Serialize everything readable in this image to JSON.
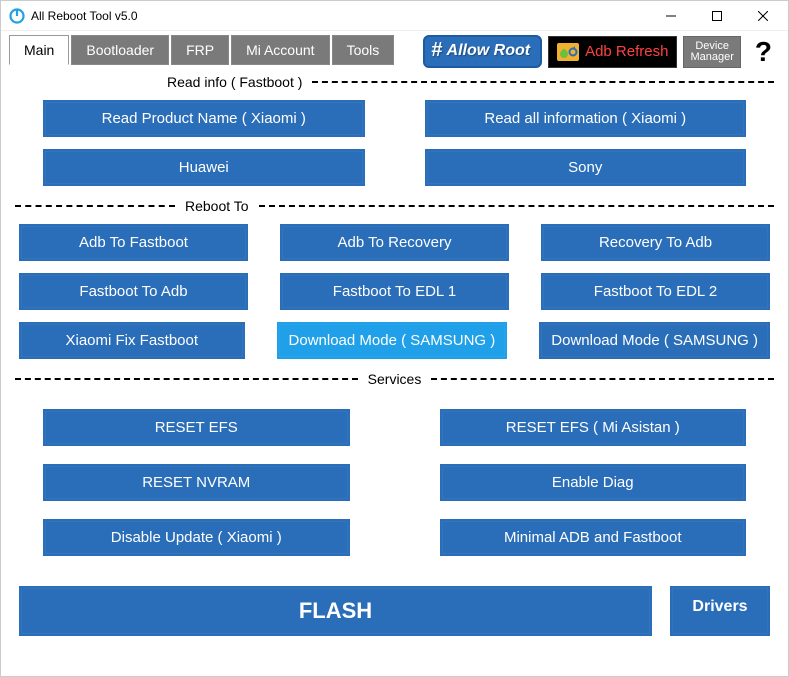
{
  "window": {
    "title": "All Reboot Tool v5.0"
  },
  "tabs": {
    "main": "Main",
    "bootloader": "Bootloader",
    "frp": "FRP",
    "mi_account": "Mi Account",
    "tools": "Tools"
  },
  "toolbar": {
    "allow_root": "Allow Root",
    "adb_refresh": "Adb Refresh",
    "device_manager": "Device\nManager",
    "help": "?"
  },
  "sections": {
    "read_info": "Read info ( Fastboot )",
    "reboot_to": "Reboot To",
    "services": "Services"
  },
  "read_info": {
    "read_product": "Read Product Name ( Xiaomi )",
    "read_all": "Read all information ( Xiaomi )",
    "huawei": "Huawei",
    "sony": "Sony"
  },
  "reboot": {
    "adb_to_fastboot": "Adb To Fastboot",
    "adb_to_recovery": "Adb To Recovery",
    "recovery_to_adb": "Recovery To Adb",
    "fastboot_to_adb": "Fastboot To Adb",
    "fastboot_to_edl1": "Fastboot To EDL 1",
    "fastboot_to_edl2": "Fastboot To EDL 2",
    "xiaomi_fix": "Xiaomi Fix Fastboot",
    "download_mode_a": "Download Mode ( SAMSUNG )",
    "download_mode_b": "Download Mode ( SAMSUNG )"
  },
  "services": {
    "reset_efs": "RESET EFS",
    "reset_efs_mi": "RESET EFS ( Mi Asistan )",
    "reset_nvram": "RESET NVRAM",
    "enable_diag": "Enable Diag",
    "disable_update": "Disable Update ( Xiaomi )",
    "minimal_adb": "Minimal ADB and Fastboot"
  },
  "footer": {
    "flash": "FLASH",
    "drivers": "Drivers"
  }
}
